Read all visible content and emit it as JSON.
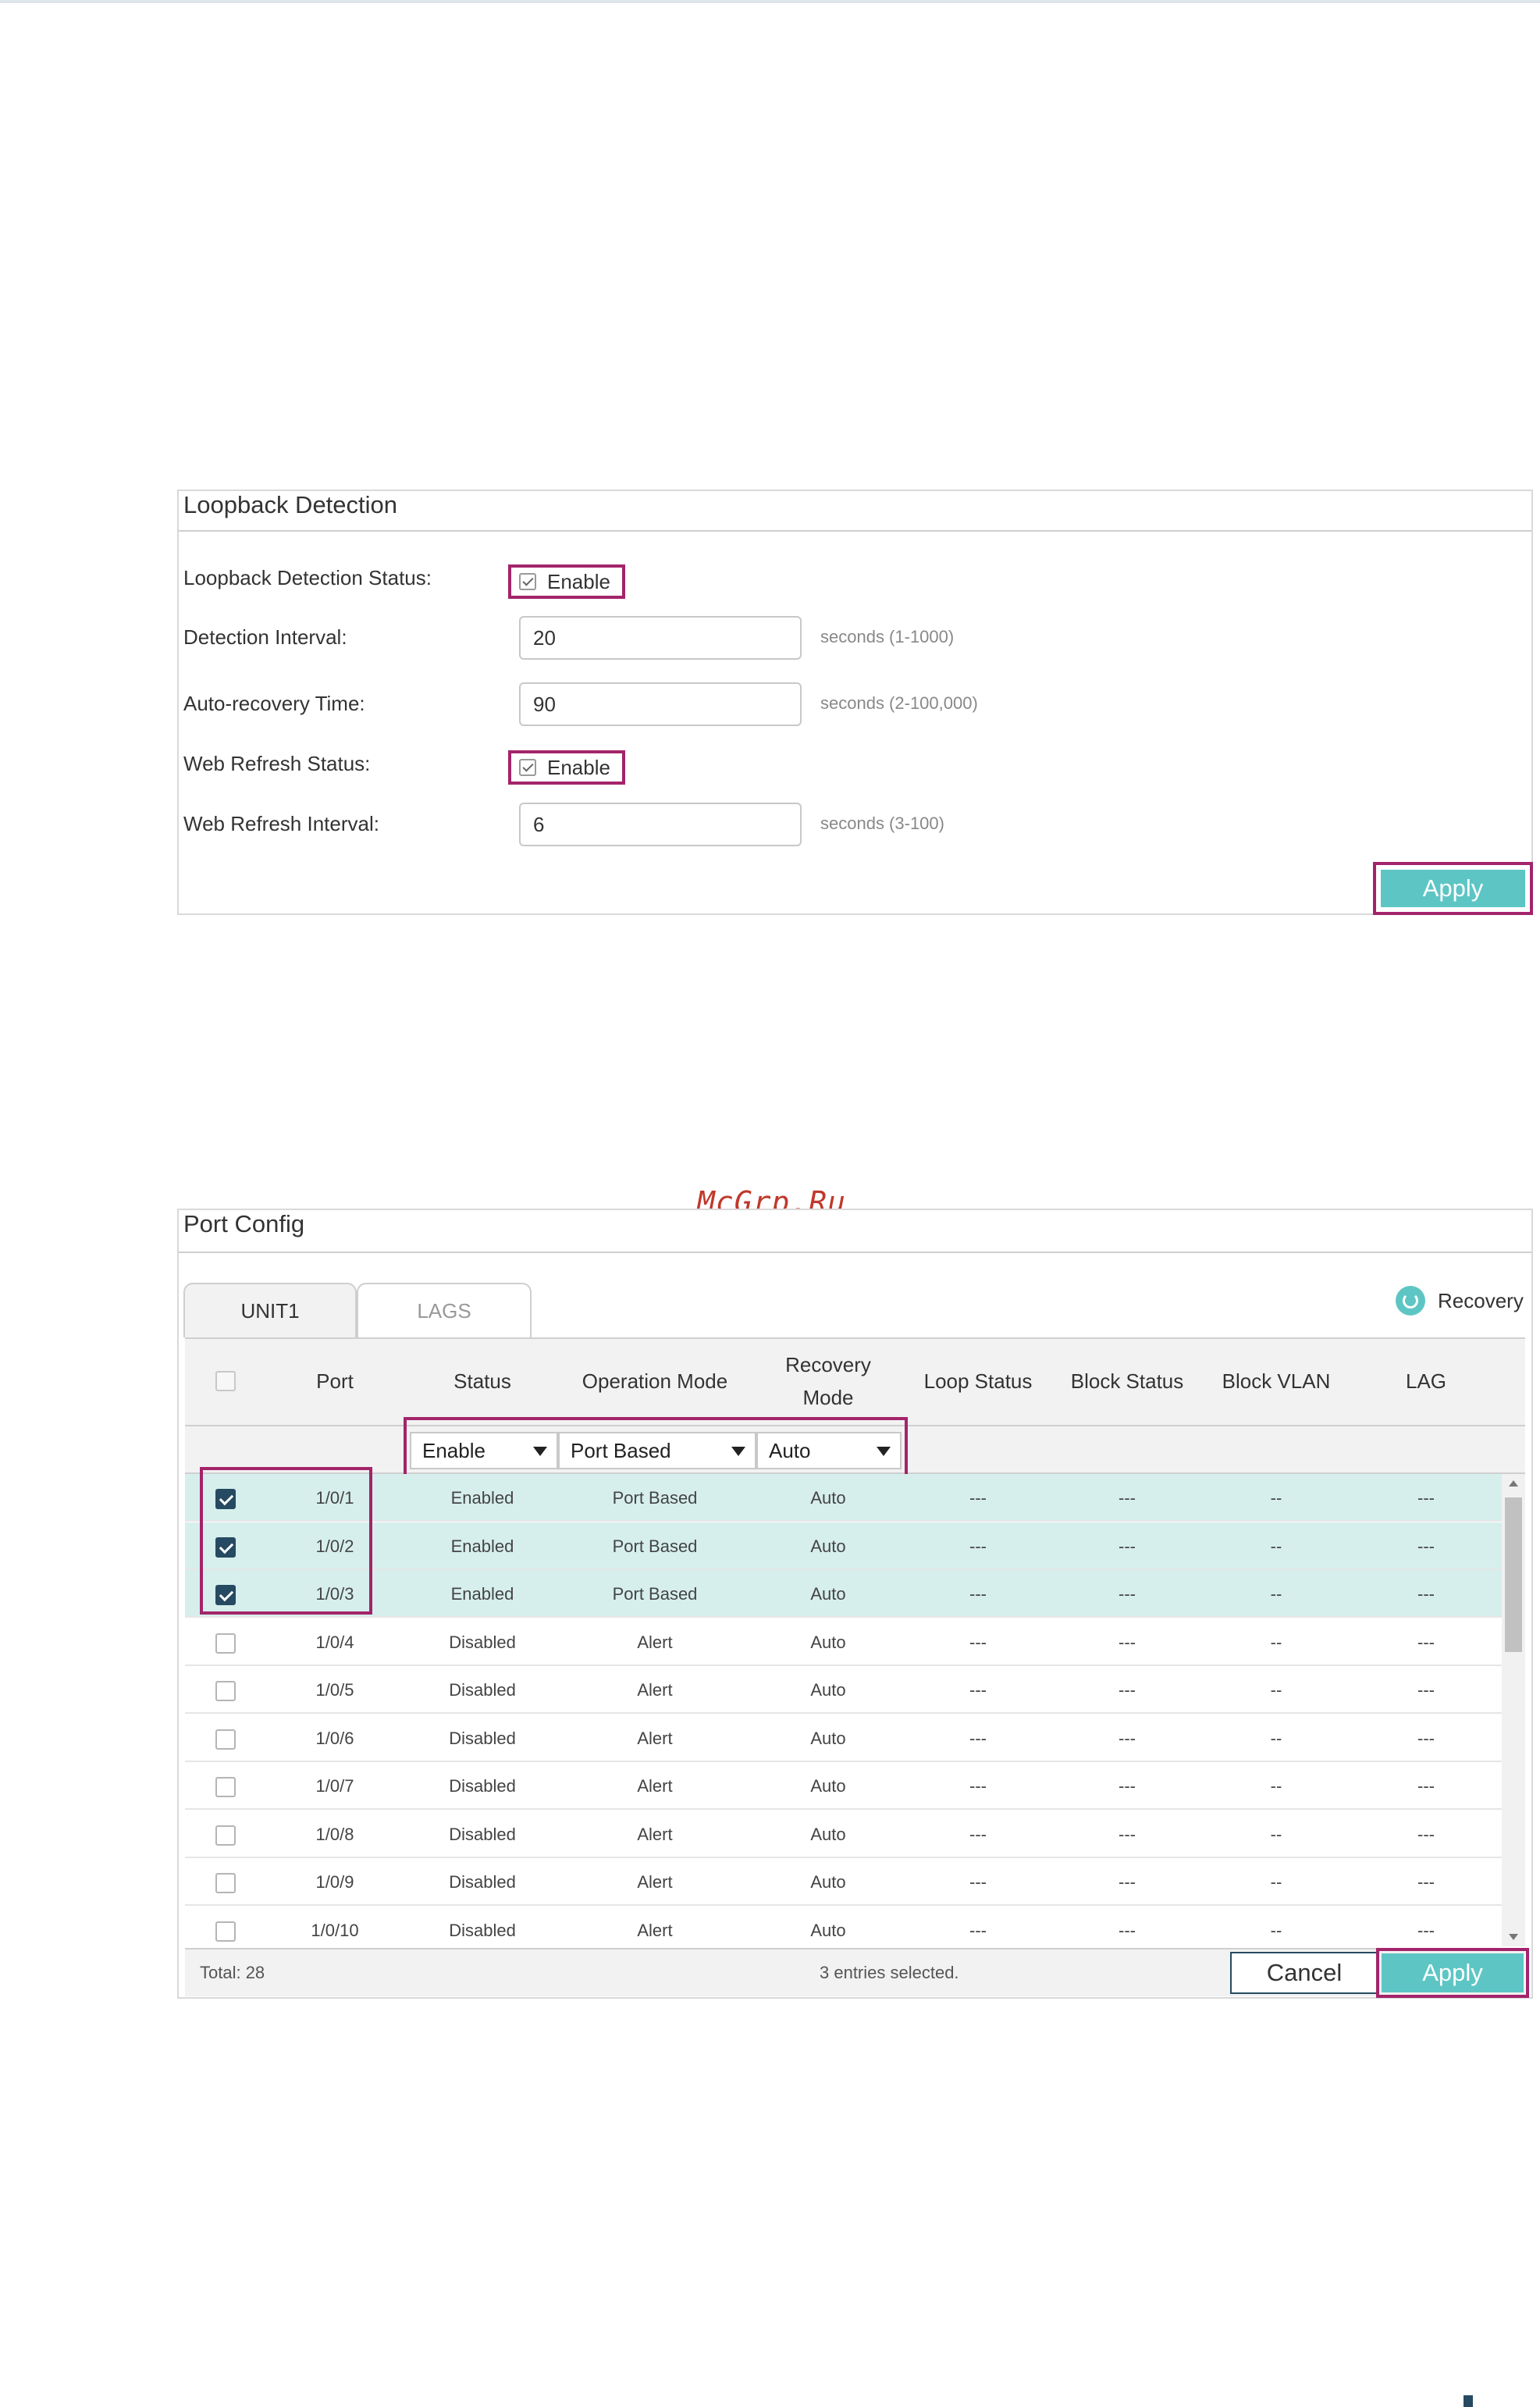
{
  "loopback": {
    "title": "Loopback Detection",
    "status_label": "Loopback Detection Status:",
    "status_enable": "Enable",
    "interval_label": "Detection Interval:",
    "interval_value": "20",
    "interval_hint": "seconds (1-1000)",
    "recovery_label": "Auto-recovery Time:",
    "recovery_value": "90",
    "recovery_hint": "seconds (2-100,000)",
    "web_status_label": "Web Refresh Status:",
    "web_status_enable": "Enable",
    "web_interval_label": "Web Refresh Interval:",
    "web_interval_value": "6",
    "web_interval_hint": "seconds (3-100)",
    "apply_label": "Apply"
  },
  "port_config": {
    "title": "Port Config",
    "tabs": [
      "UNIT1",
      "LAGS"
    ],
    "recovery_label": "Recovery",
    "headers": {
      "port": "Port",
      "status": "Status",
      "operation_mode": "Operation Mode",
      "recovery_mode_1": "Recovery",
      "recovery_mode_2": "Mode",
      "loop_status": "Loop Status",
      "block_status": "Block Status",
      "block_vlan": "Block VLAN",
      "lag": "LAG"
    },
    "filters": {
      "status": "Enable",
      "operation_mode": "Port Based",
      "recovery_mode": "Auto"
    },
    "rows": [
      {
        "port": "1/0/1",
        "status": "Enabled",
        "mode": "Port Based",
        "recovery": "Auto",
        "loop": "---",
        "block": "---",
        "vlan": "--",
        "lag": "---"
      },
      {
        "port": "1/0/2",
        "status": "Enabled",
        "mode": "Port Based",
        "recovery": "Auto",
        "loop": "---",
        "block": "---",
        "vlan": "--",
        "lag": "---"
      },
      {
        "port": "1/0/3",
        "status": "Enabled",
        "mode": "Port Based",
        "recovery": "Auto",
        "loop": "---",
        "block": "---",
        "vlan": "--",
        "lag": "---"
      },
      {
        "port": "1/0/4",
        "status": "Disabled",
        "mode": "Alert",
        "recovery": "Auto",
        "loop": "---",
        "block": "---",
        "vlan": "--",
        "lag": "---"
      },
      {
        "port": "1/0/5",
        "status": "Disabled",
        "mode": "Alert",
        "recovery": "Auto",
        "loop": "---",
        "block": "---",
        "vlan": "--",
        "lag": "---"
      },
      {
        "port": "1/0/6",
        "status": "Disabled",
        "mode": "Alert",
        "recovery": "Auto",
        "loop": "---",
        "block": "---",
        "vlan": "--",
        "lag": "---"
      },
      {
        "port": "1/0/7",
        "status": "Disabled",
        "mode": "Alert",
        "recovery": "Auto",
        "loop": "---",
        "block": "---",
        "vlan": "--",
        "lag": "---"
      },
      {
        "port": "1/0/8",
        "status": "Disabled",
        "mode": "Alert",
        "recovery": "Auto",
        "loop": "---",
        "block": "---",
        "vlan": "--",
        "lag": "---"
      },
      {
        "port": "1/0/9",
        "status": "Disabled",
        "mode": "Alert",
        "recovery": "Auto",
        "loop": "---",
        "block": "---",
        "vlan": "--",
        "lag": "---"
      },
      {
        "port": "1/0/10",
        "status": "Disabled",
        "mode": "Alert",
        "recovery": "Auto",
        "loop": "---",
        "block": "---",
        "vlan": "--",
        "lag": "---"
      }
    ],
    "selected_rows": [
      true,
      true,
      true,
      false,
      false,
      false,
      false,
      false,
      false,
      false
    ],
    "total_label": "Total: 28",
    "selected_label": "3 entries selected.",
    "cancel_label": "Cancel",
    "apply_label": "Apply"
  },
  "watermark": "McGrp.Ru",
  "colors": {
    "accent": "#5dc6c4",
    "highlight_border": "#a3246a",
    "checkbox_checked": "#264a61",
    "selected_row": "#d6efed"
  }
}
